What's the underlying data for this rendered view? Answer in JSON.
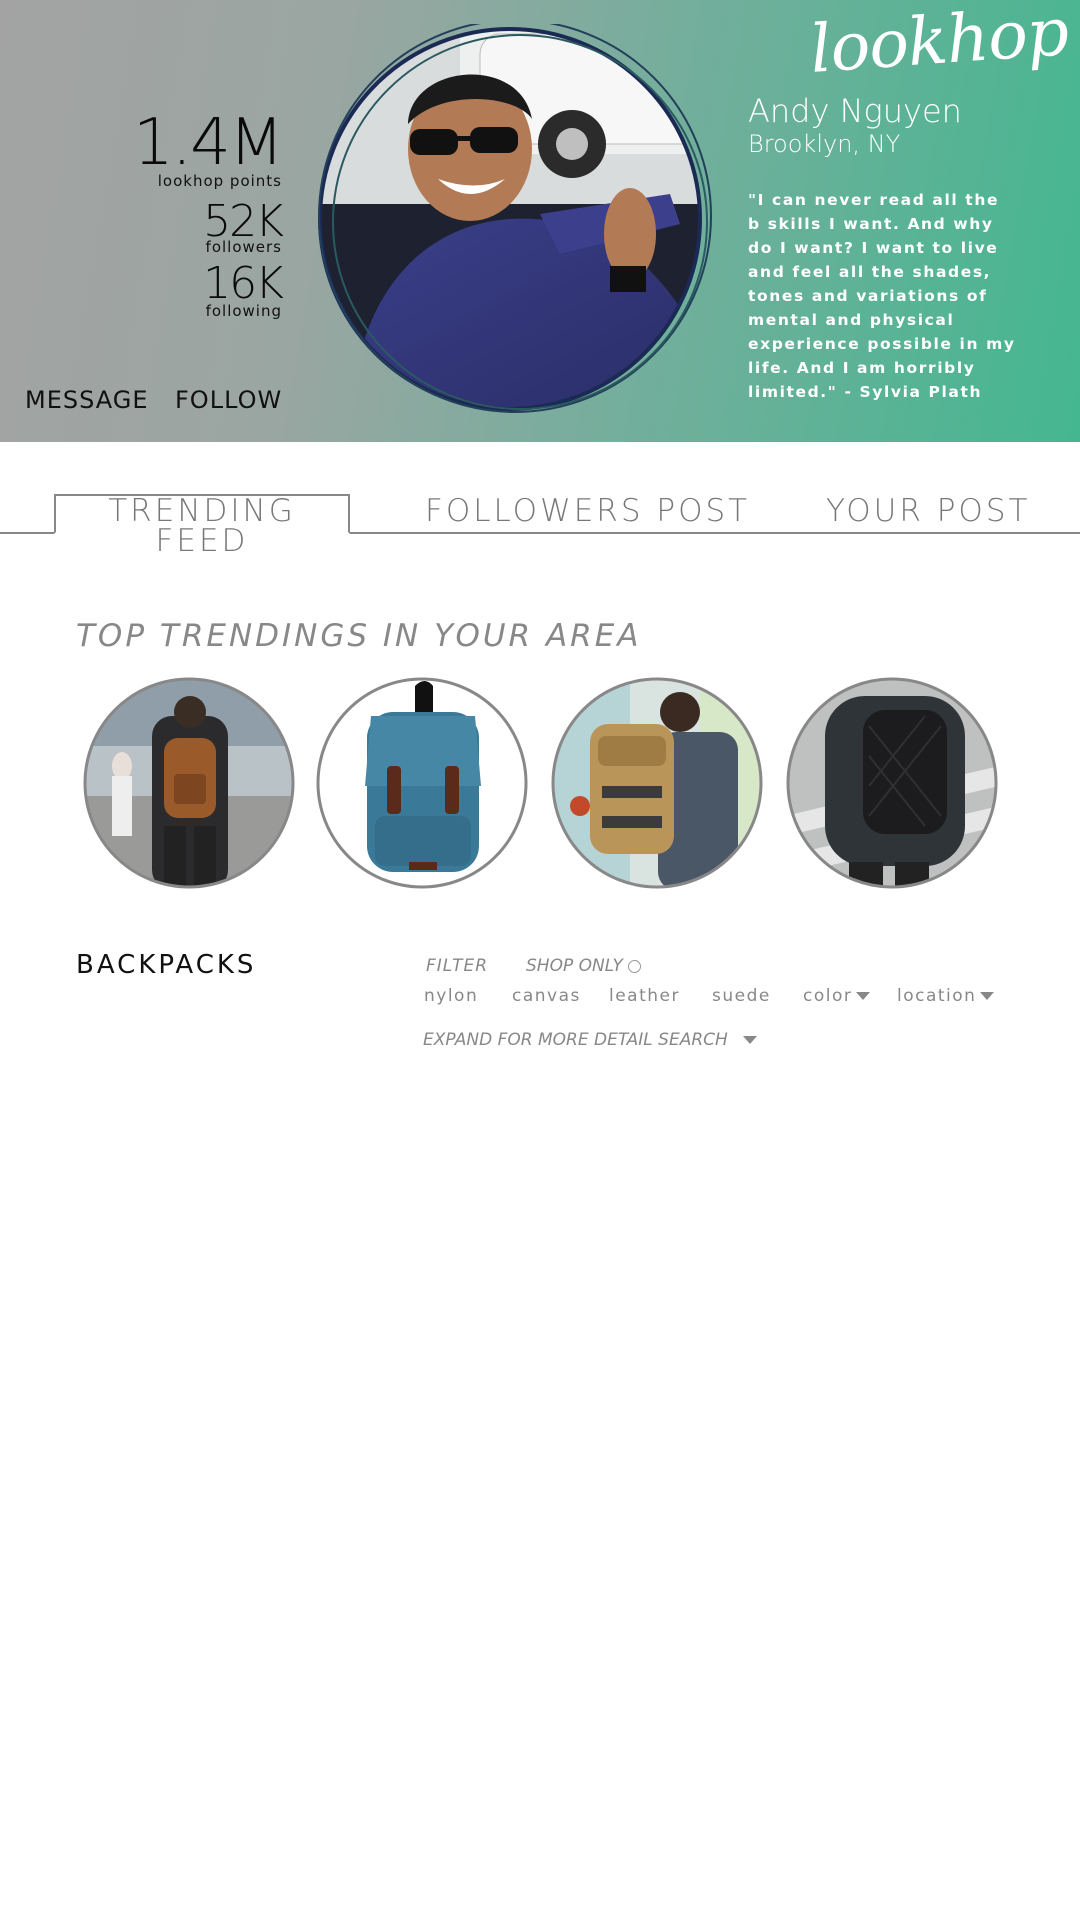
{
  "brand": {
    "logo": "lookhop"
  },
  "profile": {
    "points_value": "1.4M",
    "points_label": "lookhop points",
    "followers_value": "52K",
    "followers_label": "followers",
    "following_value": "16K",
    "following_label": "following",
    "name": "Andy Nguyen",
    "location": "Brooklyn, NY",
    "quote": "\"I can never read all the b skills I want. And why do I want? I want to live and feel all the shades, tones and variations of mental and physical experience possible in my life. And I am horribly limited.\" - Sylvia Plath",
    "message_label": "MESSAGE",
    "follow_label": "FOLLOW"
  },
  "tabs": [
    {
      "label": "TRENDING FEED",
      "active": true
    },
    {
      "label": "FOLLOWERS POST",
      "active": false
    },
    {
      "label": "YOUR POST",
      "active": false
    }
  ],
  "trending": {
    "title": "TOP TRENDINGS IN YOUR AREA",
    "items": [
      {
        "icon": "brown-backpack-photo"
      },
      {
        "icon": "blue-backpack-photo"
      },
      {
        "icon": "tan-backpack-photo"
      },
      {
        "icon": "black-backpack-photo"
      }
    ]
  },
  "category": {
    "title": "BACKPACKS",
    "filter_label": "FILTER",
    "shop_only_label": "SHOP ONLY",
    "shop_only_checked": false,
    "chips": [
      "nylon",
      "canvas",
      "leather",
      "suede",
      "color",
      "location"
    ],
    "expand_label": "EXPAND FOR MORE DETAIL SEARCH"
  },
  "colors": {
    "accent": "#44b790",
    "header_gray": "#a3a3a3",
    "muted_text": "#888888"
  }
}
